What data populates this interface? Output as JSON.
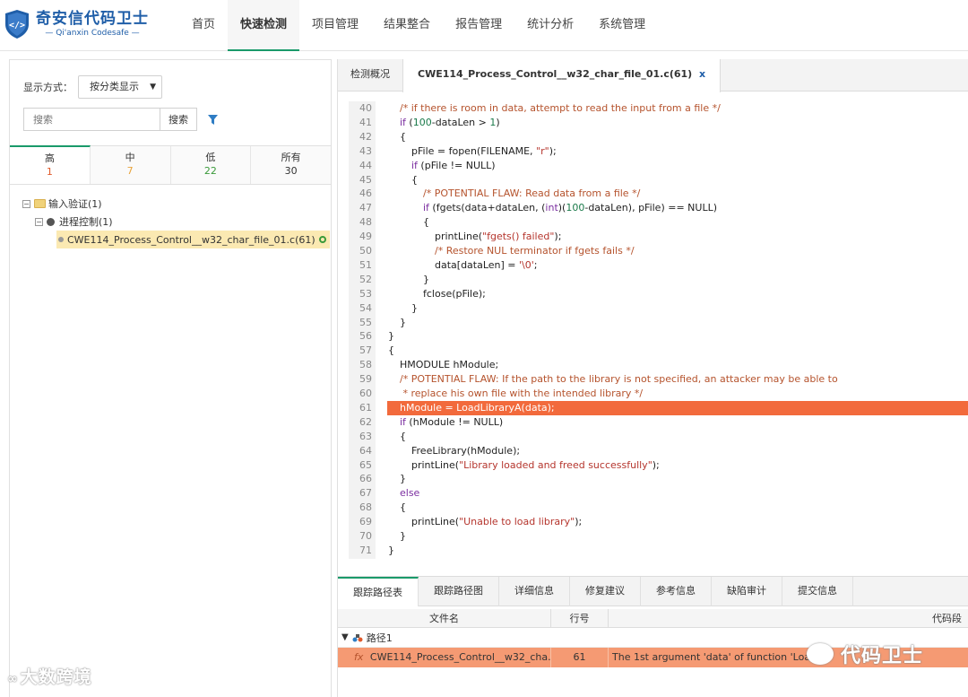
{
  "brand": {
    "name_cn": "奇安信代码卫士",
    "name_en": "Qi'anxin Codesafe",
    "color": "#1f5ea8"
  },
  "nav": [
    {
      "label": "首页",
      "active": false
    },
    {
      "label": "快速检测",
      "active": true
    },
    {
      "label": "项目管理",
      "active": false
    },
    {
      "label": "结果整合",
      "active": false
    },
    {
      "label": "报告管理",
      "active": false
    },
    {
      "label": "统计分析",
      "active": false
    },
    {
      "label": "系统管理",
      "active": false
    }
  ],
  "left": {
    "display_label": "显示方式：",
    "display_value": "按分类显示",
    "search_placeholder": "搜索",
    "search_button": "搜索",
    "severity": [
      {
        "label": "高",
        "count": "1",
        "color": "#e05a2b",
        "active": true
      },
      {
        "label": "中",
        "count": "7",
        "color": "#e8a33a",
        "active": false
      },
      {
        "label": "低",
        "count": "22",
        "color": "#3a9a3a",
        "active": false
      },
      {
        "label": "所有",
        "count": "30",
        "color": "#333333",
        "active": false
      }
    ],
    "tree": {
      "category": "输入验证(1)",
      "subcategory": "进程控制(1)",
      "leaf": "CWE114_Process_Control__w32_char_file_01.c(61)"
    }
  },
  "tabs": {
    "overview": "检测概况",
    "file": "CWE114_Process_Control__w32_char_file_01.c(61)",
    "close": "x"
  },
  "code": {
    "highlight_line": 61,
    "lines": [
      {
        "n": "40",
        "indent": 1,
        "text": "/* if there is room in data, attempt to read the input from a file */",
        "kind": "comment"
      },
      {
        "n": "41",
        "indent": 1,
        "text": "if (100-dataLen > 1)",
        "kind": "code"
      },
      {
        "n": "42",
        "indent": 1,
        "text": "{",
        "kind": "code"
      },
      {
        "n": "43",
        "indent": 2,
        "text": "pFile = fopen(FILENAME, \"r\");",
        "kind": "code"
      },
      {
        "n": "44",
        "indent": 2,
        "text": "if (pFile != NULL)",
        "kind": "code"
      },
      {
        "n": "45",
        "indent": 2,
        "text": "{",
        "kind": "code"
      },
      {
        "n": "46",
        "indent": 3,
        "text": "/* POTENTIAL FLAW: Read data from a file */",
        "kind": "comment"
      },
      {
        "n": "47",
        "indent": 3,
        "text": "if (fgets(data+dataLen, (int)(100-dataLen), pFile) == NULL)",
        "kind": "code"
      },
      {
        "n": "48",
        "indent": 3,
        "text": "{",
        "kind": "code"
      },
      {
        "n": "49",
        "indent": 4,
        "text": "printLine(\"fgets() failed\");",
        "kind": "code"
      },
      {
        "n": "50",
        "indent": 4,
        "text": "/* Restore NUL terminator if fgets fails */",
        "kind": "comment"
      },
      {
        "n": "51",
        "indent": 4,
        "text": "data[dataLen] = '\\0';",
        "kind": "code"
      },
      {
        "n": "52",
        "indent": 3,
        "text": "}",
        "kind": "code"
      },
      {
        "n": "53",
        "indent": 3,
        "text": "fclose(pFile);",
        "kind": "code"
      },
      {
        "n": "54",
        "indent": 2,
        "text": "}",
        "kind": "code"
      },
      {
        "n": "55",
        "indent": 1,
        "text": "}",
        "kind": "code"
      },
      {
        "n": "56",
        "indent": 0,
        "text": "}",
        "kind": "code"
      },
      {
        "n": "57",
        "indent": 0,
        "text": "{",
        "kind": "code"
      },
      {
        "n": "58",
        "indent": 1,
        "text": "HMODULE hModule;",
        "kind": "code"
      },
      {
        "n": "59",
        "indent": 1,
        "text": "/* POTENTIAL FLAW: If the path to the library is not specified, an attacker may be able to",
        "kind": "comment"
      },
      {
        "n": "60",
        "indent": 1,
        "text": " * replace his own file with the intended library */",
        "kind": "comment"
      },
      {
        "n": "61",
        "indent": 1,
        "text": "hModule = LoadLibraryA(data);",
        "kind": "code"
      },
      {
        "n": "62",
        "indent": 1,
        "text": "if (hModule != NULL)",
        "kind": "code"
      },
      {
        "n": "63",
        "indent": 1,
        "text": "{",
        "kind": "code"
      },
      {
        "n": "64",
        "indent": 2,
        "text": "FreeLibrary(hModule);",
        "kind": "code"
      },
      {
        "n": "65",
        "indent": 2,
        "text": "printLine(\"Library loaded and freed successfully\");",
        "kind": "code"
      },
      {
        "n": "66",
        "indent": 1,
        "text": "}",
        "kind": "code"
      },
      {
        "n": "67",
        "indent": 1,
        "text": "else",
        "kind": "code"
      },
      {
        "n": "68",
        "indent": 1,
        "text": "{",
        "kind": "code"
      },
      {
        "n": "69",
        "indent": 2,
        "text": "printLine(\"Unable to load library\");",
        "kind": "code"
      },
      {
        "n": "70",
        "indent": 1,
        "text": "}",
        "kind": "code"
      },
      {
        "n": "71",
        "indent": 0,
        "text": "}",
        "kind": "code"
      }
    ]
  },
  "bottom": {
    "tabs": [
      "跟踪路径表",
      "跟踪路径图",
      "详细信息",
      "修复建议",
      "参考信息",
      "缺陷审计",
      "提交信息"
    ],
    "columns": {
      "file": "文件名",
      "line": "行号",
      "snippet": "代码段"
    },
    "path_label": "路径1",
    "row": {
      "fx": "fx",
      "file": "CWE114_Process_Control__w32_cha...",
      "line": "61",
      "snippet": "The 1st argument 'data' of function 'Loa"
    }
  },
  "watermarks": {
    "left": "大数跨境",
    "right": "代码卫士"
  },
  "colors": {
    "accent": "#1a9a6a",
    "highlight": "#f26a3c",
    "comment": "#b5532d",
    "keyword": "#7b2ea0",
    "string": "#b5352d"
  }
}
